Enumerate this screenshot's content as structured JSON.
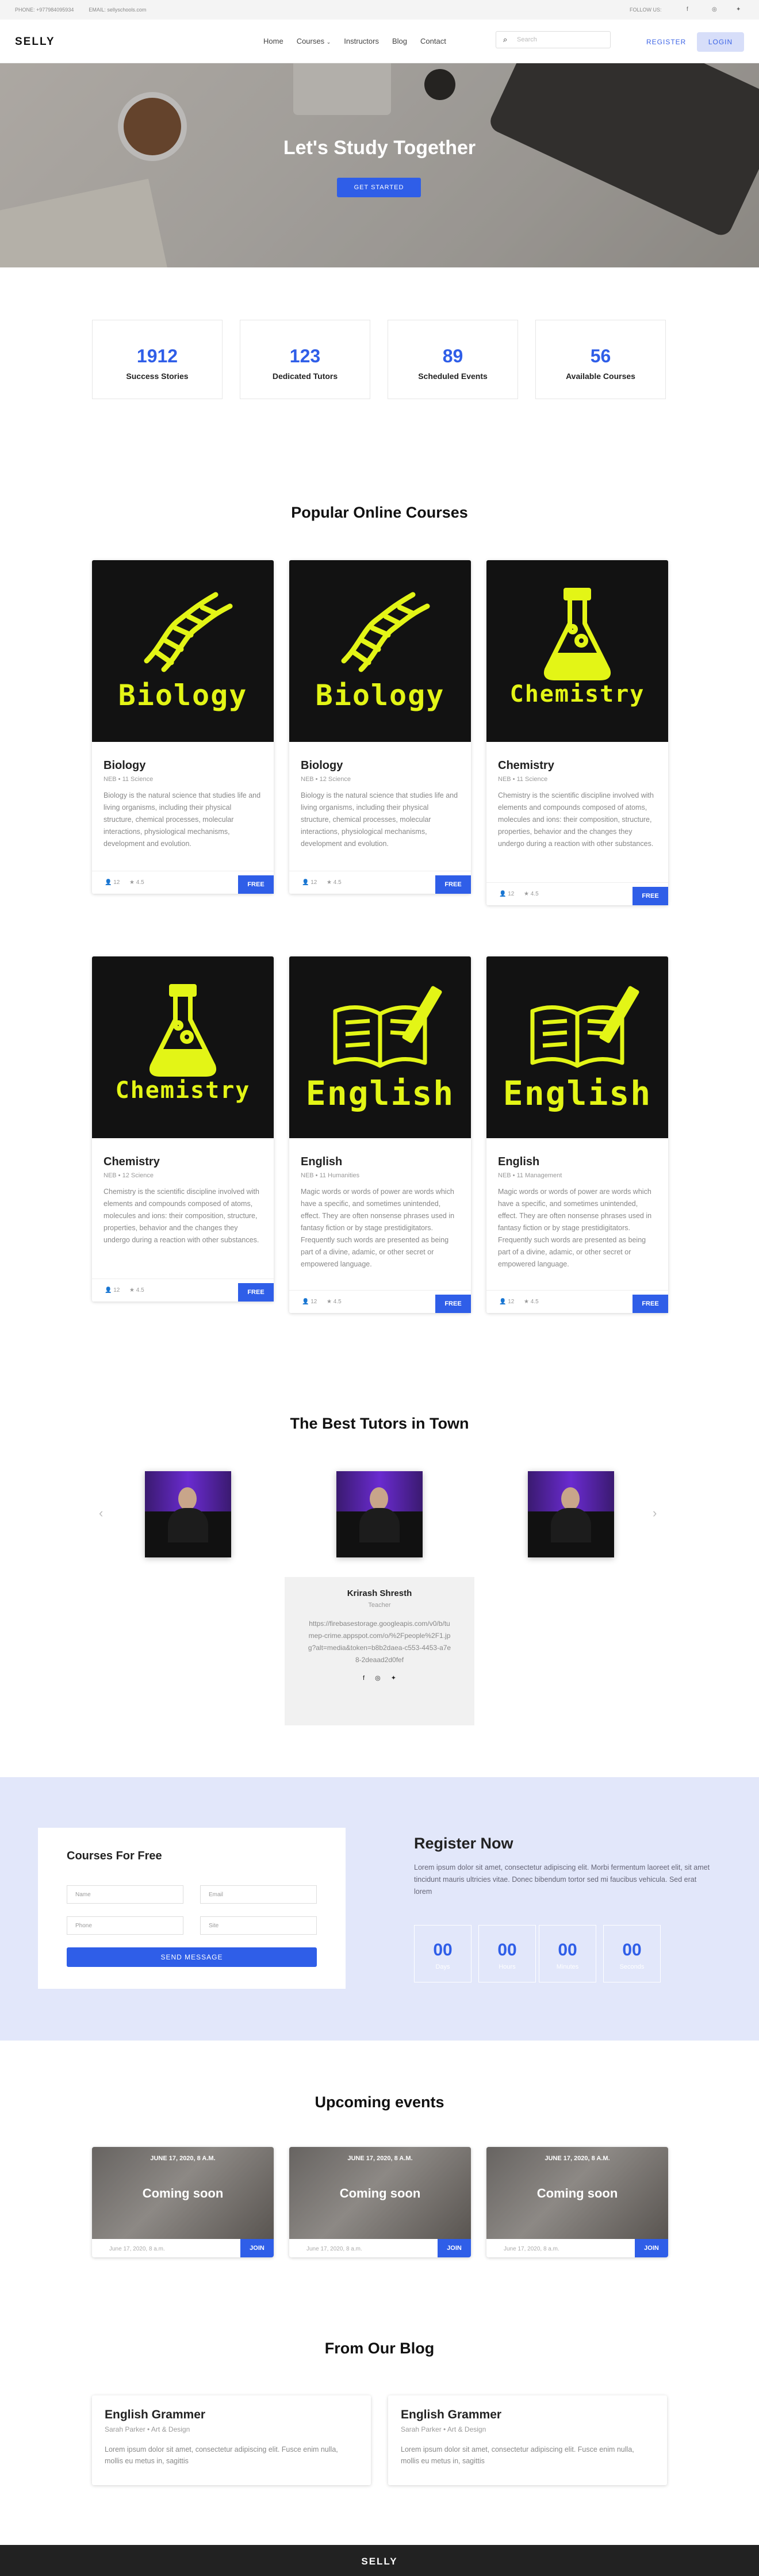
{
  "topbar": {
    "phone": "PHONE: +977984095934",
    "email": "EMAIL: sellyschools.com",
    "follow": "FOLLOW US:"
  },
  "nav": {
    "logo": "SELLY",
    "menu": [
      "Home",
      "Courses",
      "Instructors",
      "Blog",
      "Contact"
    ],
    "search_placeholder": "Search",
    "register": "REGISTER",
    "login": "LOGIN"
  },
  "hero": {
    "title": "Let's Study Together",
    "button": "GET STARTED"
  },
  "stats": [
    {
      "value": "1912",
      "label": "Success Stories"
    },
    {
      "value": "123",
      "label": "Dedicated Tutors"
    },
    {
      "value": "89",
      "label": "Scheduled Events"
    },
    {
      "value": "56",
      "label": "Available Courses"
    }
  ],
  "courses": {
    "heading": "Popular Online Courses",
    "items": [
      {
        "logo": "Biology",
        "title": "Biology",
        "meta": "NEB  •  11 Science",
        "desc": "Biology is the natural science that studies life and living organisms, including their physical structure, chemical processes, molecular interactions, physiological mechanisms, development and evolution.",
        "students": "12",
        "rating": "4.5",
        "badge": "FREE"
      },
      {
        "logo": "Biology",
        "title": "Biology",
        "meta": "NEB  •  12 Science",
        "desc": "Biology is the natural science that studies life and living organisms, including their physical structure, chemical processes, molecular interactions, physiological mechanisms, development and evolution.",
        "students": "12",
        "rating": "4.5",
        "badge": "FREE"
      },
      {
        "logo": "Chemistry",
        "title": "Chemistry",
        "meta": "NEB  •  11 Science",
        "desc": "Chemistry is the scientific discipline involved with elements and compounds composed of atoms, molecules and ions: their composition, structure, properties, behavior and the changes they undergo during a reaction with other substances.",
        "students": "12",
        "rating": "4.5",
        "badge": "FREE"
      },
      {
        "logo": "Chemistry",
        "title": "Chemistry",
        "meta": "NEB  •  12 Science",
        "desc": "Chemistry is the scientific discipline involved with elements and compounds composed of atoms, molecules and ions: their composition, structure, properties, behavior and the changes they undergo during a reaction with other substances.",
        "students": "12",
        "rating": "4.5",
        "badge": "FREE"
      },
      {
        "logo": "English",
        "title": "English",
        "meta": "NEB  •  11 Humanities",
        "desc": "Magic words or words of power are words which have a specific, and sometimes unintended, effect. They are often nonsense phrases used in fantasy fiction or by stage prestidigitators. Frequently such words are presented as being part of a divine, adamic, or other secret or empowered language.",
        "students": "12",
        "rating": "4.5",
        "badge": "FREE"
      },
      {
        "logo": "English",
        "title": "English",
        "meta": "NEB  •  11 Management",
        "desc": "Magic words or words of power are words which have a specific, and sometimes unintended, effect. They are often nonsense phrases used in fantasy fiction or by stage prestidigitators. Frequently such words are presented as being part of a divine, adamic, or other secret or empowered language.",
        "students": "12",
        "rating": "4.5",
        "badge": "FREE"
      }
    ]
  },
  "tutors": {
    "heading": "The Best Tutors in Town",
    "name": "Krirash Shresth",
    "role": "Teacher",
    "desc": "https://firebasestorage.googleapis.com/v0/b/tumep-crime.appspot.com/o/%2Fpeople%2F1.jpg?alt=media&token=b8b2daea-c553-4453-a7e8-2deaad2d0fef"
  },
  "register": {
    "form_title": "Courses For Free",
    "fields": [
      "Name",
      "Email",
      "Phone",
      "Site"
    ],
    "send": "SEND MESSAGE",
    "heading": "Register Now",
    "text": "Lorem ipsum dolor sit amet, consectetur adipiscing elit. Morbi fermentum laoreet elit, sit amet tincidunt mauris ultricies vitae. Donec bibendum tortor sed mi faucibus vehicula. Sed erat lorem",
    "countdown": [
      {
        "value": "00",
        "unit": "Days"
      },
      {
        "value": "00",
        "unit": "Hours"
      },
      {
        "value": "00",
        "unit": "Minutes"
      },
      {
        "value": "00",
        "unit": "Seconds"
      }
    ]
  },
  "events": {
    "heading": "Upcoming events",
    "items": [
      {
        "date": "JUNE 17, 2020, 8 A.M.",
        "status": "Coming soon",
        "foot": "June 17, 2020, 8 a.m.",
        "join": "JOIN"
      },
      {
        "date": "JUNE 17, 2020, 8 A.M.",
        "status": "Coming soon",
        "foot": "June 17, 2020, 8 a.m.",
        "join": "JOIN"
      },
      {
        "date": "JUNE 17, 2020, 8 A.M.",
        "status": "Coming soon",
        "foot": "June 17, 2020, 8 a.m.",
        "join": "JOIN"
      }
    ]
  },
  "blog": {
    "heading": "From Our Blog",
    "items": [
      {
        "title": "English Grammer",
        "meta": "Sarah Parker  •  Art & Design",
        "desc": "Lorem ipsum dolor sit amet, consectetur adipiscing elit. Fusce enim nulla, mollis eu metus in, sagittis"
      },
      {
        "title": "English Grammer",
        "meta": "Sarah Parker  •  Art & Design",
        "desc": "Lorem ipsum dolor sit amet, consectetur adipiscing elit. Fusce enim nulla, mollis eu metus in, sagittis"
      }
    ]
  },
  "footer": {
    "logo": "SELLY"
  },
  "colors": {
    "accent": "#2f5ee8",
    "logo_yellow": "#e3f516",
    "card_dark": "#121212",
    "register_bg": "#e2e7fa"
  }
}
